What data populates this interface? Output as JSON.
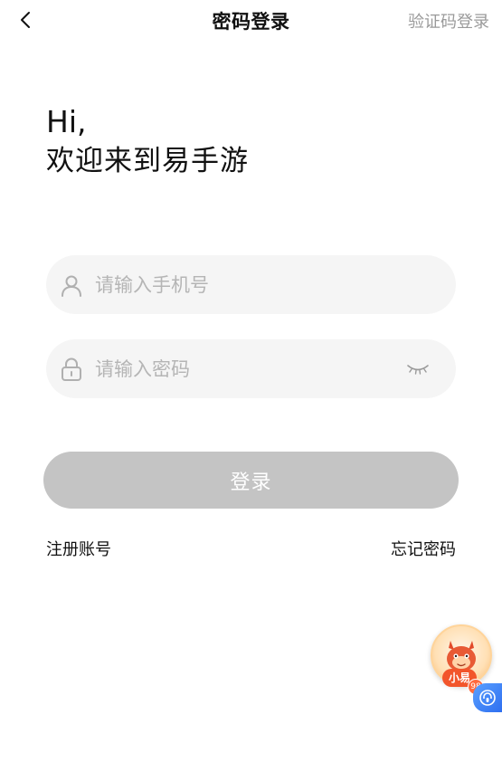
{
  "header": {
    "title": "密码登录",
    "switch_label": "验证码登录"
  },
  "greeting": {
    "hi": "Hi,",
    "welcome": "欢迎来到易手游"
  },
  "form": {
    "phone_placeholder": "请输入手机号",
    "password_placeholder": "请输入密码",
    "login_label": "登录"
  },
  "links": {
    "register": "注册账号",
    "forgot": "忘记密码"
  },
  "assistant": {
    "badge": "小易",
    "count": "98"
  },
  "colors": {
    "field_bg": "#f5f5f5",
    "button_disabled": "#c4c4c4",
    "muted_text": "#9a9a9a",
    "placeholder": "#b5b5b5",
    "badge_red": "#f2552b"
  },
  "icons": [
    "back-icon",
    "user-icon",
    "lock-icon",
    "eye-closed-icon",
    "assistant-avatar-icon",
    "headset-icon"
  ]
}
